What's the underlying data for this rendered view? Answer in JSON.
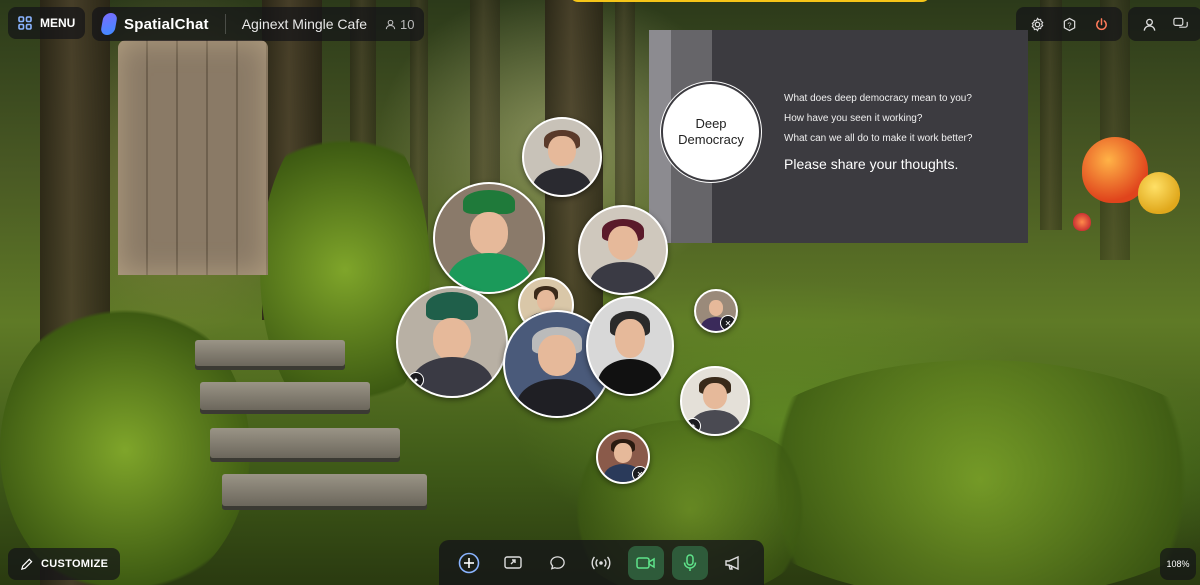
{
  "topbar": {
    "menu_label": "MENU",
    "brand_name": "SpatialChat",
    "room_name": "Aginext Mingle Cafe",
    "participant_count": "10"
  },
  "slide": {
    "circle_line1": "Deep",
    "circle_line2": "Democracy",
    "questions": [
      "What does deep democracy mean to you?",
      "How have you seen it working?",
      "What can we all do to make it work better?"
    ],
    "call_to_action": "Please share your thoughts."
  },
  "icons": {
    "menu": "grid-icon",
    "settings": "gear-icon",
    "help": "help-icon",
    "leave": "power-icon",
    "profile": "user-icon",
    "chats": "chat-bubbles-icon",
    "customize": "pencil-icon"
  },
  "dock": {
    "buttons": [
      "add-icon",
      "share-screen-icon",
      "chat-icon",
      "broadcast-icon",
      "camera-icon",
      "microphone-icon",
      "megaphone-icon"
    ]
  },
  "bottom": {
    "customize_label": "CUSTOMIZE",
    "zoom_level": "108%"
  },
  "colors": {
    "accent_yellow": "#f5c518",
    "active_button": "#2e5b3a",
    "panel_bg": "#141418"
  }
}
